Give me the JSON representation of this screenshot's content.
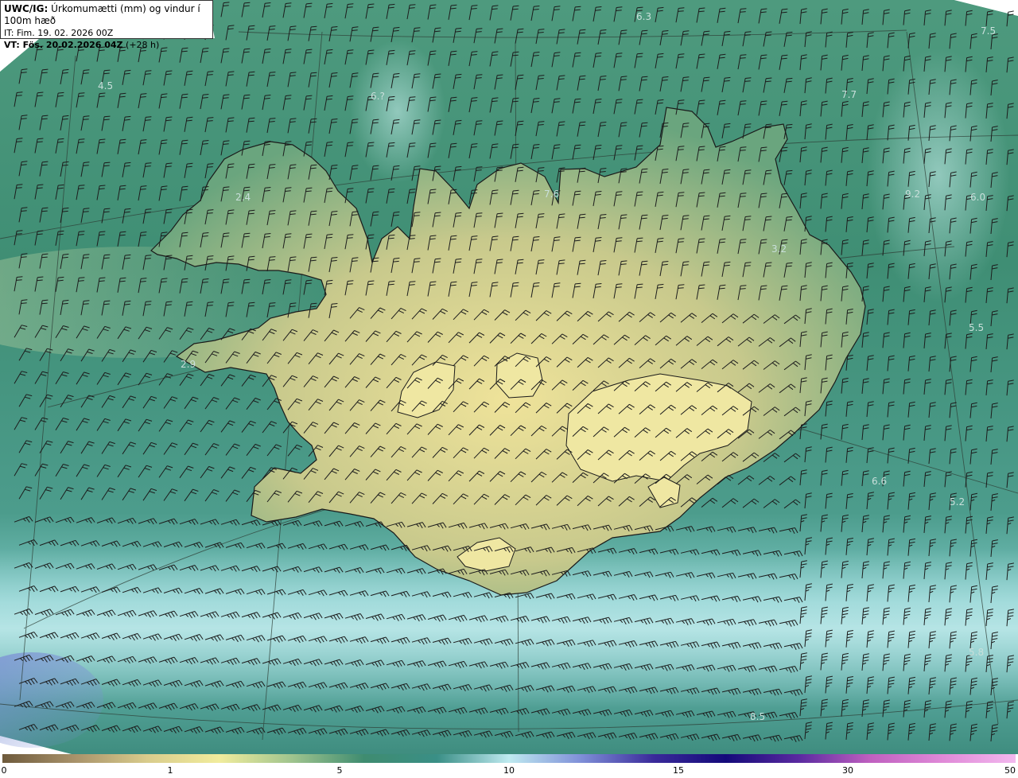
{
  "header": {
    "product": "UWC/IG:",
    "title": "Úrkomumætti (mm) og vindur í 100m hæð",
    "init_time": "IT: Fim. 19. 02. 2026 00Z",
    "valid_label": "VT: Fös. 20.02.2026 04Z",
    "lead": "(+28 h)"
  },
  "map": {
    "region": "Iceland",
    "field": "precipitable water (mm)",
    "overlay": "wind barbs at 100 m",
    "value_labels": [
      "6.3",
      "7.5",
      "4.5",
      "6.?",
      "7.7",
      "2.4",
      "7.6",
      "9.2",
      "6.0",
      "3.2",
      "5.5",
      "2.9",
      "6.6",
      "5.2",
      "5.8",
      "8.5"
    ]
  },
  "colorbar": {
    "ticks": [
      "0",
      "1",
      "5",
      "10",
      "15",
      "30",
      "50"
    ],
    "colors": [
      "#6e5a3c",
      "#a8926a",
      "#d9cc8c",
      "#f1ec9c",
      "#9fc48e",
      "#3f8c70",
      "#3a8f86",
      "#bfeaf0",
      "#7f8fd8",
      "#3a2a9a",
      "#140a7a",
      "#5a2aa0",
      "#c060c0",
      "#e08ad8",
      "#f2b8ee"
    ]
  }
}
